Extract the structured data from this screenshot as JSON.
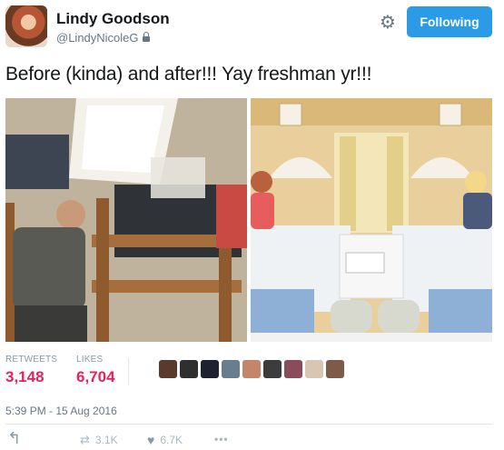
{
  "author": {
    "name": "Lindy Goodson",
    "handle": "@LindyNicoleG",
    "follow_label": "Following"
  },
  "tweet": {
    "text": "Before (kinda) and after!!! Yay freshman yr!!!",
    "timestamp": "5:39 PM - 15 Aug 2016"
  },
  "stats": {
    "retweets_label": "RETWEETS",
    "retweets_value": "3,148",
    "likes_label": "LIKES",
    "likes_value": "6,704"
  },
  "actions": {
    "retweet_count": "3.1K",
    "like_count": "6.7K",
    "more": "•••"
  },
  "icons": {
    "settings": "gear-icon",
    "lock": "lock-icon",
    "reply": "reply-icon",
    "retweet": "retweet-icon",
    "like": "heart-icon",
    "more": "more-icon"
  },
  "colors": {
    "follow_button": "#2b9be8",
    "stat_value": "#e0245e",
    "muted": "#657786"
  }
}
